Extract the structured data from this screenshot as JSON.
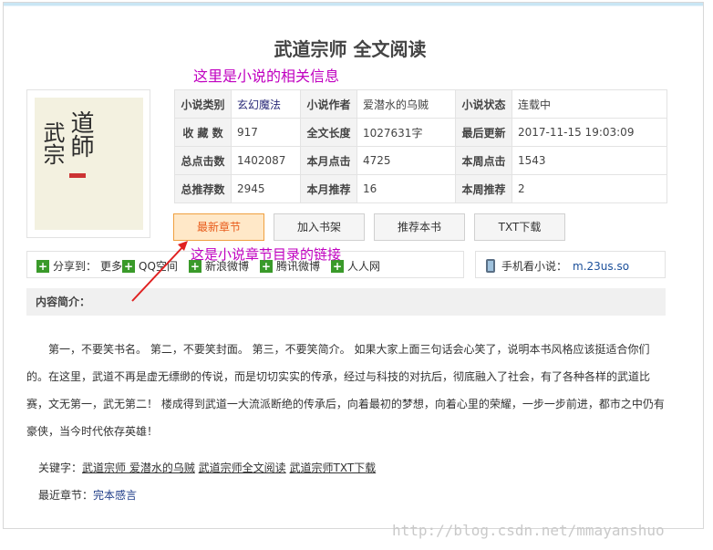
{
  "page": {
    "title": "武道宗师 全文阅读",
    "annotation_info": "这里是小说的相关信息",
    "annotation_link": "这是小说章节目录的链接",
    "watermark": "http://blog.csdn.net/mmayanshuo"
  },
  "cover": {
    "text_col1": "道師",
    "text_col2": "武宗"
  },
  "info": {
    "rows": [
      [
        "小说类别",
        "玄幻魔法",
        "小说作者",
        "爱潜水的乌贼",
        "小说状态",
        "连载中"
      ],
      [
        "收 藏 数",
        "917",
        "全文长度",
        "1027631字",
        "最后更新",
        "2017-11-15 19:03:09"
      ],
      [
        "总点击数",
        "1402087",
        "本月点击",
        "4725",
        "本周点击",
        "1543"
      ],
      [
        "总推荐数",
        "2945",
        "本月推荐",
        "16",
        "本周推荐",
        "2"
      ]
    ]
  },
  "buttons": {
    "latest": "最新章节",
    "bookshelf": "加入书架",
    "recommend": "推荐本书",
    "txt": "TXT下载"
  },
  "share": {
    "label": "分享到：",
    "more": "更多",
    "qq": "QQ空间",
    "sina": "新浪微博",
    "tencent": "腾讯微博",
    "renren": "人人网"
  },
  "mobile": {
    "label": "手机看小说：",
    "url": "m.23us.so"
  },
  "intro": {
    "heading": "内容简介：",
    "text": "第一，不要笑书名。 第二，不要笑封面。 第三，不要笑简介。 如果大家上面三句话会心笑了，说明本书风格应该挺适合你们的。在这里，武道不再是虚无缥缈的传说，而是切切实实的传承，经过与科技的对抗后，彻底融入了社会，有了各种各样的武道比赛，文无第一，武无第二！ 楼成得到武道一大流派断绝的传承后，向着最初的梦想，向着心里的荣耀，一步一步前进，都市之中仍有豪侠，当今时代依存英雄！"
  },
  "keywords": {
    "label": "关键字：",
    "k1": "武道宗师 爱潜水的乌贼",
    "k2": "武道宗师全文阅读",
    "k3": "武道宗师TXT下载"
  },
  "latest": {
    "label": "最近章节：",
    "chapter": "完本感言"
  },
  "colors": {
    "annotation": "#c000c0",
    "info_border": "#d63a3a",
    "primary_button": "#ffe8c8",
    "share_plus": "#3a9a2a"
  }
}
